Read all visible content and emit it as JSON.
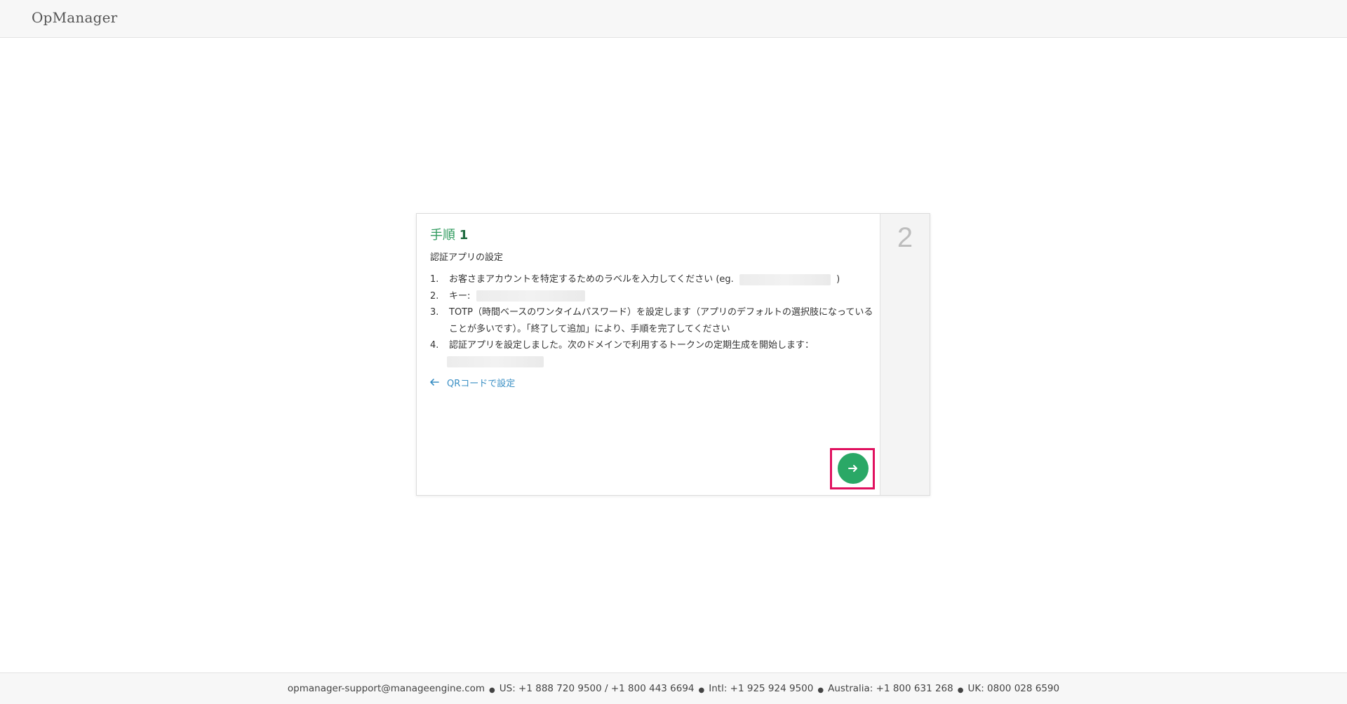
{
  "header": {
    "brand": "OpManager"
  },
  "card": {
    "step_label": "手順",
    "step_number": "1",
    "next_step_number": "2",
    "subtitle": "認証アプリの設定",
    "items": [
      {
        "index": "1.",
        "text": "お客さまアカウントを特定するためのラベルを入力してください (eg.",
        "suffix": ")"
      },
      {
        "index": "2.",
        "text": "キー:"
      },
      {
        "index": "3.",
        "text": "TOTP（時間ベースのワンタイムパスワード）を設定します（アプリのデフォルトの選択肢になっていることが多いです）。「終了して追加」により、手順を完了してください"
      },
      {
        "index": "4.",
        "text": "認証アプリを設定しました。次のドメインで利用するトークンの定期生成を開始します："
      }
    ],
    "back_link": "QRコードで設定",
    "next_button_icon": "arrow-right-icon",
    "colors": {
      "accent": "#2aa866",
      "highlight": "#e0115f",
      "link": "#3a8fc4"
    }
  },
  "footer": {
    "email": "opmanager-support@manageengine.com",
    "us": "US: +1 888 720 9500 / +1 800 443 6694",
    "intl": "Intl: +1 925 924 9500",
    "australia": "Australia: +1 800 631 268",
    "uk": "UK: 0800 028 6590",
    "separator": "●"
  }
}
